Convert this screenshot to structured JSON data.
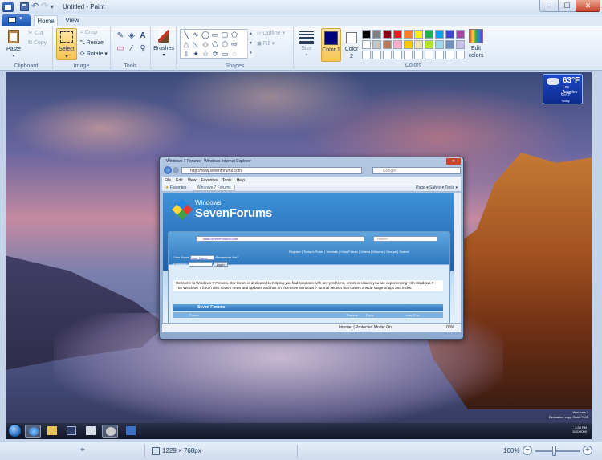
{
  "window": {
    "title": "Untitled - Paint",
    "minimize": "–",
    "maximize": "☐",
    "close": "✕"
  },
  "tabs": [
    "Home",
    "View"
  ],
  "ribbon": {
    "clipboard": {
      "label": "Clipboard",
      "paste": "Paste",
      "cut": "Cut",
      "copy": "Copy"
    },
    "image": {
      "label": "Image",
      "select": "Select",
      "crop": "Crop",
      "resize": "Resize",
      "rotate": "Rotate ▾"
    },
    "tools": {
      "label": "Tools"
    },
    "brushes": {
      "label": "Brushes"
    },
    "shapes": {
      "label": "Shapes",
      "outline": "Outline ▾",
      "fill": "Fill ▾"
    },
    "size": {
      "label": "Size"
    },
    "colors": {
      "label": "Colors",
      "color1": "Color 1",
      "color2": "Color 2",
      "edit": "Edit colors",
      "color1_value": "#00007f",
      "color2_value": "#ffffff",
      "palette_row1": [
        "#000000",
        "#7f7f7f",
        "#880015",
        "#ed1c24",
        "#ff7f27",
        "#fff200",
        "#22b14c",
        "#00a2e8",
        "#3f48cc",
        "#a349a4"
      ],
      "palette_row2": [
        "#ffffff",
        "#c3c3c3",
        "#b97a57",
        "#ffaec9",
        "#ffc90e",
        "#efe4b0",
        "#b5e61d",
        "#99d9ea",
        "#7092be",
        "#c8bfe7"
      ],
      "palette_row3": [
        "#ffffff",
        "#ffffff",
        "#ffffff",
        "#ffffff",
        "#ffffff",
        "#ffffff",
        "#ffffff",
        "#ffffff",
        "#ffffff",
        "#ffffff"
      ]
    }
  },
  "canvas": {
    "gadget": {
      "temp": "63°F",
      "city": "Los Angeles",
      "low": "60°F",
      "day": "Today"
    },
    "ie": {
      "title": "Windows 7 Forums - Windows Internet Explorer",
      "address": "http://www.sevenforums.com/",
      "search_placeholder": "Google",
      "menu": [
        "File",
        "Edit",
        "View",
        "Favorites",
        "Tools",
        "Help"
      ],
      "favorites": "Favorites",
      "fav_tab": "Windows 7 Forums",
      "toolbar_right": "Page ▾  Safety ▾  Tools ▾",
      "status": "Internet | Protected Mode: On",
      "zoom": "100%",
      "page": {
        "logo_small": "Windows",
        "logo_big": "SevenForums",
        "inner_address": "www.SevenForums.com",
        "inner_search": "Search",
        "links": "Register | Today's Posts | Tutorials | Vista Forum | Videos | Albums | Groups | Search",
        "user_label": "User Name",
        "user_value": "User Name",
        "remember": "Remember Me?",
        "password_label": "Password",
        "login": "Login",
        "welcome": "Welcome to Windows 7 Forums. Our forum is dedicated to helping you find solutions with any problems, errors or issues you are experiencing with Windows 7. The Windows 7 forum also covers news and updates and has an extensive Windows 7 tutorial section that covers a wide range of tips and tricks.",
        "section": "Seven Forums",
        "col_forum": "Forum",
        "col_threads": "Threads",
        "col_posts": "Posts",
        "col_last": "Last Post"
      }
    },
    "tray_time": "3:38 PM",
    "tray_date": "5/11/2009",
    "eval_line1": "Windows 7",
    "eval_line2": "Evaluation copy. Build 7100"
  },
  "status": {
    "size": "1229 × 768px",
    "zoom": "100%",
    "zoom_level_percent": 100
  }
}
